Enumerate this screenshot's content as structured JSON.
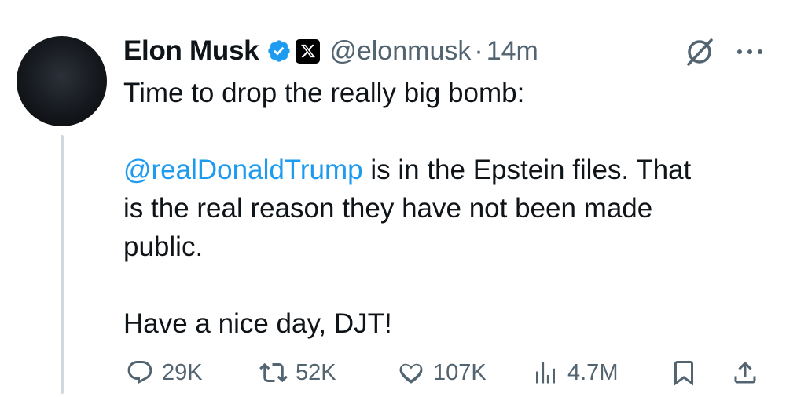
{
  "author": {
    "name": "Elon Musk",
    "handle": "@elonmusk",
    "separator": "·",
    "time": "14m"
  },
  "tweet": {
    "line1": "Time to drop the really big bomb:",
    "mention": "@realDonaldTrump",
    "line2_rest": " is in the Epstein files. That",
    "line3": "is the real reason they have not been made",
    "line4": "public.",
    "line5": "Have a nice day, DJT!"
  },
  "actions": {
    "replies": "29K",
    "reposts": "52K",
    "likes": "107K",
    "views": "4.7M"
  },
  "colors": {
    "link": "#1d9bf0",
    "verified": "#1d9bf0",
    "muted": "#536471",
    "thread_line": "#cfd9de"
  },
  "icons": [
    "verified-badge-icon",
    "x-logo-icon",
    "grok-icon",
    "more-icon",
    "reply-icon",
    "repost-icon",
    "like-icon",
    "views-icon",
    "bookmark-icon",
    "share-icon"
  ]
}
